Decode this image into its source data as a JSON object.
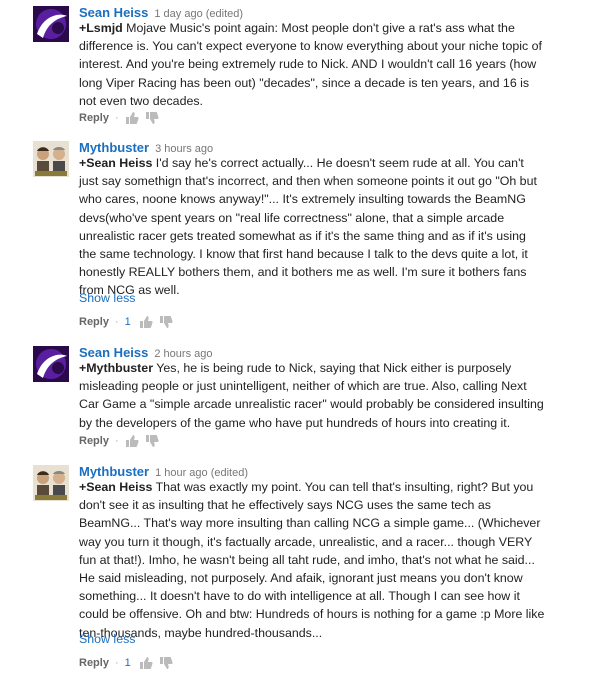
{
  "comments": [
    {
      "author": "Sean Heiss",
      "time": "1 day ago (edited)",
      "mention": "+Lsmjd",
      "lines": [
        " Mojave Music's point again: Most people don't give a rat's ass what the",
        "difference is. You can't expect everyone to know everything about your niche topic of",
        "interest. And you're being extremely rude to Nick. AND I wouldn't call 16 years (how",
        "long Viper Racing has been out) \"decades\", since a decade is ten years, and 16 is",
        "not even two decades."
      ],
      "reply_label": "Reply"
    },
    {
      "author": "Mythbuster",
      "time": "3 hours ago",
      "mention": "+Sean Heiss",
      "lines": [
        " I'd say he's correct actually... He doesn't seem rude at all. You can't",
        "just say somethign that's incorrect, and then when someone points it out go \"Oh but",
        "who cares, noone knows anyway!\"... It's extremely insulting towards the BeamNG",
        "devs(who've spent years on \"real life correctness\" alone, that a simple arcade",
        "unrealistic racer gets treated somewhat as if it's the same thing and as if it's using",
        "the same technology. I know that first hand because I talk to the devs quite a lot, it",
        "honestly REALLY bothers them, and it bothers me as well. I'm sure it bothers fans",
        "from NCG as well."
      ],
      "show_less": "Show less",
      "reply_label": "Reply",
      "likes": "1"
    },
    {
      "author": "Sean Heiss",
      "time": "2 hours ago",
      "mention": "+Mythbuster",
      "lines": [
        " Yes, he is being rude to Nick, saying that Nick either is purposely",
        "misleading people or just unintelligent, neither of which are true. Also, calling Next",
        "Car Game a \"simple arcade unrealistic racer\" would probably be considered insulting",
        "by the developers of the game who have put hundreds of hours into creating it."
      ],
      "reply_label": "Reply"
    },
    {
      "author": "Mythbuster",
      "time": "1 hour ago (edited)",
      "mention": "+Sean Heiss",
      "lines": [
        " That was exactly my point. You can tell that's insulting, right? But you",
        "don't see it as insulting that he effectively says NCG uses the same tech as",
        "BeamNG... That's way more insulting than calling NCG a simple game... (Whichever",
        "way you turn it though, it's factually arcade, unrealistic, and a racer... though VERY",
        "fun at that!). Imho, he wasn't being all taht rude, and imho, that's not what he said...",
        "He said misleading, not purposely. And afaik, ignorant just means you don't know",
        "something... It doesn't have to do with intelligence at all. Though I can see how it",
        "could be offensive. Oh and btw: Hundreds of hours is nothing for a game :p More like",
        "ten-thousands, maybe hundred-thousands..."
      ],
      "show_less": "Show less",
      "reply_label": "Reply",
      "likes": "1"
    }
  ]
}
